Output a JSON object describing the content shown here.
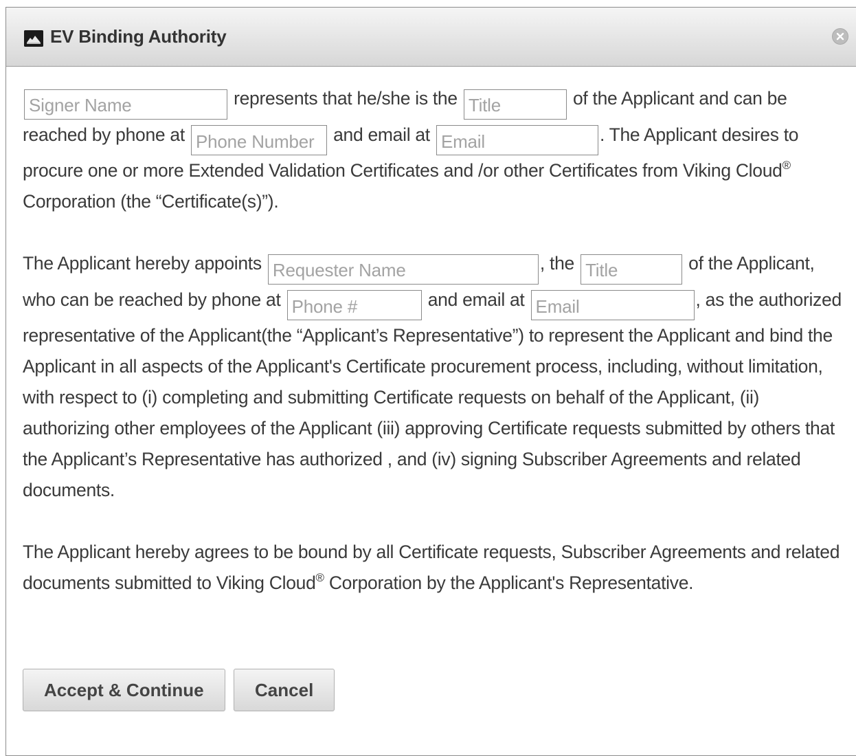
{
  "dialog": {
    "title": "EV Binding Authority",
    "icon": "app-logo-icon",
    "close_icon": "close-icon"
  },
  "paragraph1": {
    "signer_name_placeholder": "Signer Name",
    "text1": "represents that he/she is the",
    "title_placeholder": "Title",
    "text2": "of the Applicant and can be reached by phone at",
    "phone_placeholder": "Phone Number",
    "text3": "and email at",
    "email_placeholder": "Email",
    "text4": ". The Applicant desires to procure one or more Extended Validation Certificates and /or other Certificates from Viking Cloud",
    "reg_mark": "®",
    "text5": " Corporation (the “Certificate(s)”)."
  },
  "paragraph2": {
    "text1": "The Applicant hereby appoints",
    "requester_name_placeholder": "Requester Name",
    "text2": ", the",
    "title_placeholder": "Title",
    "text3": "of the Applicant, who can be reached by phone at",
    "phone_placeholder": "Phone #",
    "text4": "and email at",
    "email_placeholder": "Email",
    "text5": ", as the authorized representative of the Applicant(the “Applicant’s Representative”) to represent the Applicant and bind the Applicant in all aspects of the Applicant's Certificate procurement process, including, without limitation, with respect to (i) completing and submitting Certificate requests on behalf of the Applicant, (ii) authorizing other employees of the Applicant (iii) approving Certificate requests submitted by others that the Applicant’s Representative has authorized , and (iv) signing Subscriber Agreements and related documents."
  },
  "paragraph3": {
    "text1": "The Applicant hereby agrees to be bound by all Certificate requests, Subscriber Agreements and related documents submitted to Viking Cloud",
    "reg_mark": "®",
    "text2": " Corporation by the Applicant's Representative."
  },
  "buttons": {
    "accept_label": "Accept & Continue",
    "cancel_label": "Cancel"
  }
}
